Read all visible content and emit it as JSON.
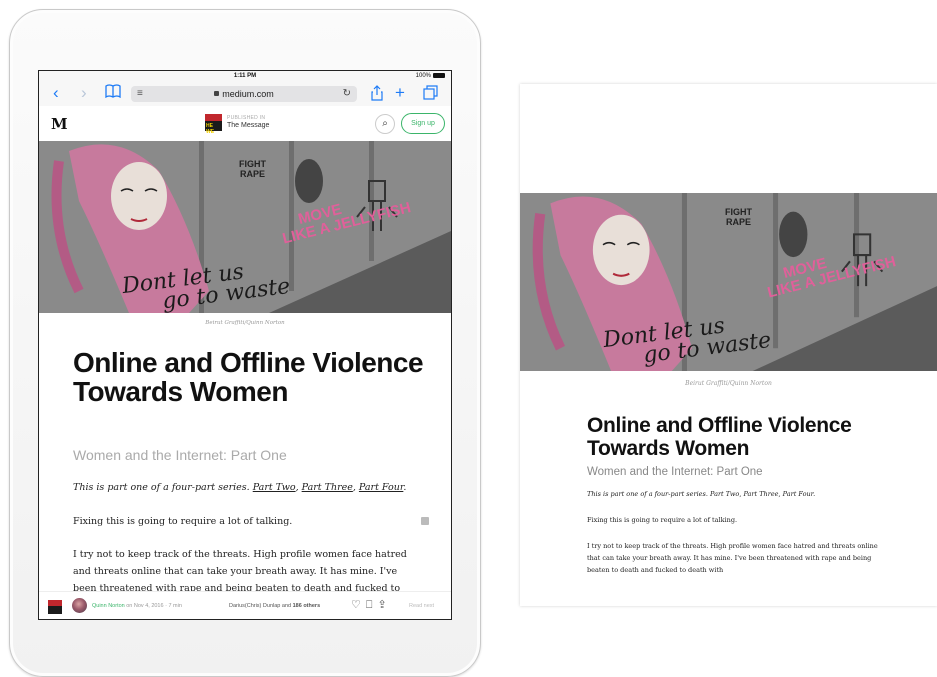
{
  "status_bar": {
    "time": "1:11 PM",
    "battery": "100%"
  },
  "browser": {
    "url": "medium.com"
  },
  "medium_header": {
    "logo": "M",
    "publication_label": "PUBLISHED IN",
    "publication_name": "The Message",
    "signup_label": "Sign up"
  },
  "hero": {
    "caption": "Beirut Graffiti/Quinn Norton",
    "graffiti_line1": "Dont let us",
    "graffiti_line2": "go to waste",
    "graffiti_fight": "FIGHT",
    "graffiti_rape": "RAPE",
    "graffiti_move": "MOVE",
    "graffiti_jelly": "LIKE A JELLYFISH"
  },
  "article": {
    "title": "Online and Offline Violence Towards Women",
    "subtitle": "Women and the Internet: Part One",
    "intro": "This is part one of a four-part series.",
    "link_part_two": "Part Two",
    "link_part_three": "Part Three",
    "link_part_four": "Part Four",
    "para1": "Fixing this is going to require a lot of talking.",
    "para2_ipad": "I try not to keep track of the threats. High profile women face hatred and threats online that can take your breath away. It has mine. I've been threatened with rape and being beaten to death and fucked to",
    "para2_page": "I try not to keep track of the threats. High profile women face hatred and threats online that can take your breath away. It has mine. I've been threatened with rape and being beaten to death and fucked to death with"
  },
  "footer": {
    "author": "Quinn Norton",
    "date_meta": "on Nov 4, 2016 · 7 min",
    "recommender": "Darius(Chris) Dunlap",
    "and_text": "and",
    "others": "186 others",
    "read_next": "Read next"
  }
}
